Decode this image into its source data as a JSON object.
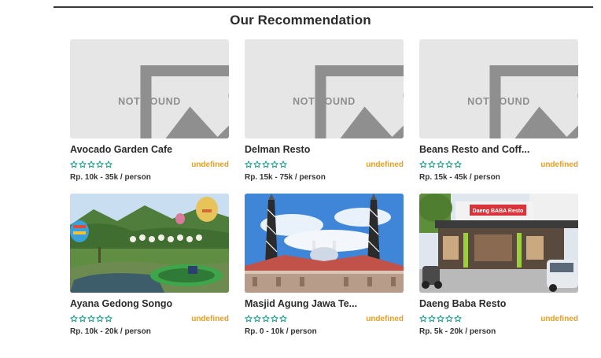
{
  "section": {
    "title": "Our Recommendation"
  },
  "colors": {
    "star": "#1a9a8a",
    "rating_text": "#e0a030",
    "placeholder_bg": "#e6e6e6"
  },
  "placeholder": {
    "text": "NOT FOUND",
    "icon": "image-icon"
  },
  "cards": [
    {
      "name": "Avocado Garden Cafe",
      "rating": "undefined",
      "stars": 5,
      "price": "Rp. 10k - 35k / person",
      "image": "placeholder"
    },
    {
      "name": "Delman Resto",
      "rating": "undefined",
      "stars": 5,
      "price": "Rp. 15k - 75k / person",
      "image": "placeholder"
    },
    {
      "name": "Beans Resto and Coff...",
      "rating": "undefined",
      "stars": 5,
      "price": "Rp. 15k - 45k / person",
      "image": "placeholder"
    },
    {
      "name": "Ayana Gedong Songo",
      "rating": "undefined",
      "stars": 5,
      "price": "Rp. 10k - 20k / person",
      "image": "park-photo"
    },
    {
      "name": "Masjid Agung Jawa Te...",
      "rating": "undefined",
      "stars": 5,
      "price": "Rp. 0 - 10k / person",
      "image": "mosque-photo"
    },
    {
      "name": "Daeng Baba Resto",
      "rating": "undefined",
      "stars": 5,
      "price": "Rp. 5k - 20k / person",
      "image": "restaurant-photo",
      "sign": "Daeng BABA Resto"
    }
  ]
}
